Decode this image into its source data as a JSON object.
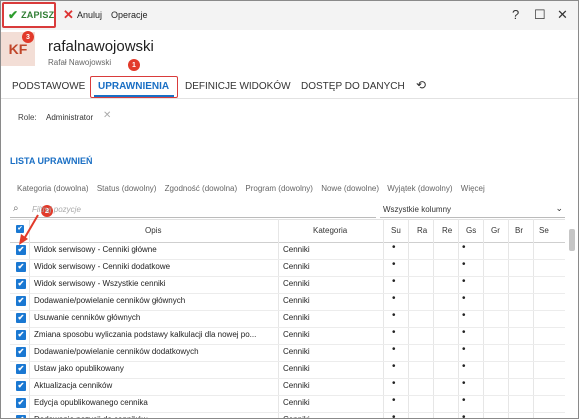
{
  "toolbar": {
    "save_label": "ZAPISZ",
    "cancel_label": "Anuluj",
    "operations_label": "Operacje",
    "help": "?",
    "maximize": "☐",
    "close": "✕"
  },
  "user": {
    "initials": "KF",
    "username": "rafalnawojowski",
    "full_name": "Rafał Nawojowski"
  },
  "badges": {
    "b1": "1",
    "b2": "2",
    "b3": "3"
  },
  "tabs": [
    {
      "label": "PODSTAWOWE"
    },
    {
      "label": "UPRAWNIENIA"
    },
    {
      "label": "DEFINICJE WIDOKÓW"
    },
    {
      "label": "DOSTĘP DO DANYCH"
    }
  ],
  "role": {
    "label": "Role:",
    "value": "Administrator"
  },
  "section_title": "LISTA UPRAWNIEŃ",
  "filters": [
    "Kategoria (dowolna)",
    "Status (dowolny)",
    "Zgodność (dowolna)",
    "Program (dowolny)",
    "Nowe (dowolne)",
    "Wyjątek (dowolny)",
    "Więcej"
  ],
  "search": {
    "placeholder": "Filtruj pozycje"
  },
  "columns_select": {
    "value": "Wszystkie kolumny"
  },
  "columns": [
    "Opis",
    "Kategoria",
    "Su",
    "Ra",
    "Re",
    "Gs",
    "Gr",
    "Br",
    "Se"
  ],
  "rows": [
    {
      "opis": "Widok serwisowy - Cenniki główne",
      "kategoria": "Cenniki",
      "su": "•",
      "gs": "•"
    },
    {
      "opis": "Widok serwisowy - Cenniki dodatkowe",
      "kategoria": "Cenniki",
      "su": "•",
      "gs": "•"
    },
    {
      "opis": "Widok serwisowy - Wszystkie cenniki",
      "kategoria": "Cenniki",
      "su": "•",
      "gs": "•"
    },
    {
      "opis": "Dodawanie/powielanie cenników głównych",
      "kategoria": "Cenniki",
      "su": "•",
      "gs": "•"
    },
    {
      "opis": "Usuwanie cenników głównych",
      "kategoria": "Cenniki",
      "su": "•",
      "gs": "•"
    },
    {
      "opis": "Zmiana sposobu wyliczania podstawy kalkulacji dla nowej po...",
      "kategoria": "Cenniki",
      "su": "•",
      "gs": "•"
    },
    {
      "opis": "Dodawanie/powielanie cenników dodatkowych",
      "kategoria": "Cenniki",
      "su": "•",
      "gs": "•"
    },
    {
      "opis": "Ustaw jako opublikowany",
      "kategoria": "Cenniki",
      "su": "•",
      "gs": "•"
    },
    {
      "opis": "Aktualizacja cenników",
      "kategoria": "Cenniki",
      "su": "•",
      "gs": "•"
    },
    {
      "opis": "Edycja opublikowanego cennika",
      "kategoria": "Cenniki",
      "su": "•",
      "gs": "•"
    },
    {
      "opis": "Dodawanie pozycji do cenników",
      "kategoria": "Cenniki",
      "su": "•",
      "gs": "•"
    }
  ]
}
